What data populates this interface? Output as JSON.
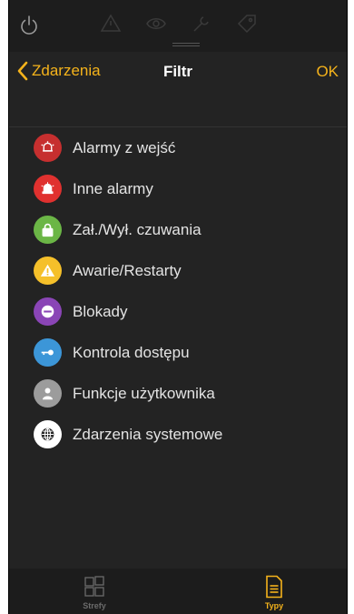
{
  "nav": {
    "back_label": "Zdarzenia",
    "title": "Filtr",
    "ok_label": "OK"
  },
  "colors": {
    "accent": "#f5b31b",
    "background": "#232323",
    "label": "#e4e4e4",
    "tab_inactive": "#6b6b6b"
  },
  "filters": [
    {
      "label": "Alarmy z wejść",
      "icon": "alarm-bell-outline-icon",
      "color": "#c62f2f"
    },
    {
      "label": "Inne alarmy",
      "icon": "alarm-bell-icon",
      "color": "#e0312f"
    },
    {
      "label": "Zał./Wył. czuwania",
      "icon": "lock-icon",
      "color": "#6bb646"
    },
    {
      "label": "Awarie/Restarty",
      "icon": "warning-icon",
      "color": "#f5c02a"
    },
    {
      "label": "Blokady",
      "icon": "block-icon",
      "color": "#8a45b6"
    },
    {
      "label": "Kontrola dostępu",
      "icon": "key-icon",
      "color": "#3c96d8"
    },
    {
      "label": "Funkcje użytkownika",
      "icon": "user-icon",
      "color": "#9c9c9c"
    },
    {
      "label": "Zdarzenia systemowe",
      "icon": "globe-icon",
      "color": "#ffffff"
    }
  ],
  "tabs": [
    {
      "label": "Strefy",
      "icon": "grid-icon",
      "active": false
    },
    {
      "label": "Typy",
      "icon": "document-icon",
      "active": true
    }
  ]
}
